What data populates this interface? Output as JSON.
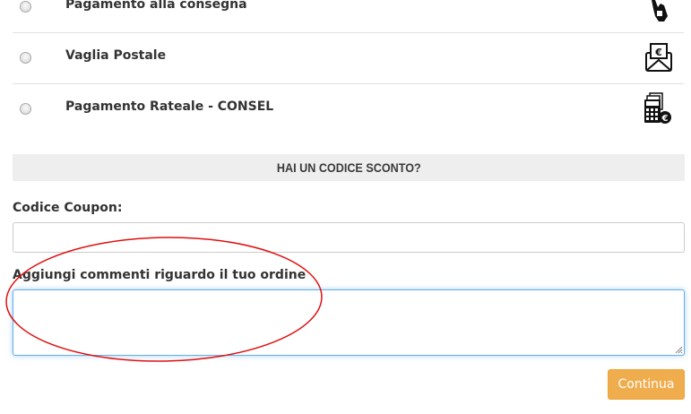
{
  "payment_methods": [
    {
      "label": "Pagamento alla consegna",
      "icon": "cash-hand-icon",
      "selected": false
    },
    {
      "label": "Vaglia Postale",
      "icon": "euro-envelope-icon",
      "selected": false
    },
    {
      "label": "Pagamento Rateale - CONSEL",
      "icon": "calculator-euro-icon",
      "selected": false
    }
  ],
  "discount": {
    "heading": "HAI UN CODICE SCONTO?"
  },
  "coupon": {
    "label": "Codice Coupon:",
    "value": ""
  },
  "comments": {
    "label": "Aggiungi commenti riguardo il tuo ordine",
    "value": ""
  },
  "actions": {
    "continue_label": "Continua"
  },
  "colors": {
    "accent_button": "#f0ad4e",
    "focus_border": "#66afe9",
    "annotation": "#e01010",
    "section_bar": "#eeeeee"
  }
}
